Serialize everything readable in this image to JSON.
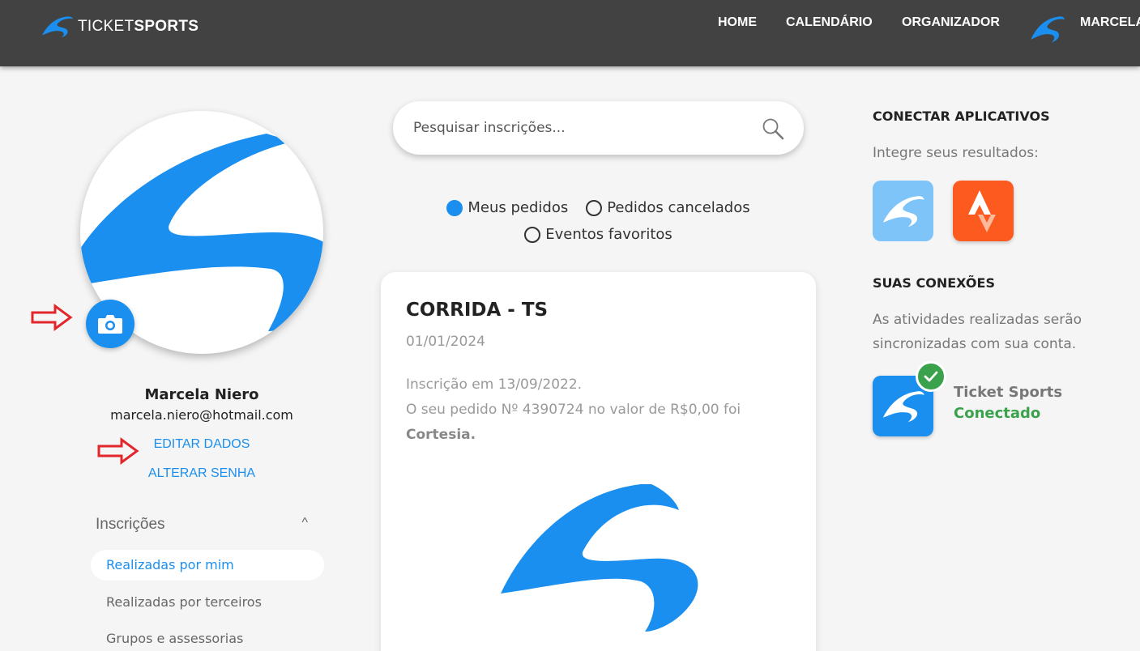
{
  "header": {
    "brand_prefix": "TICKET",
    "brand_bold": "SPORTS",
    "nav": [
      "HOME",
      "CALENDÁRIO",
      "ORGANIZADOR",
      "MARCELA"
    ]
  },
  "profile": {
    "name": "Marcela Niero",
    "email": "marcela.niero@hotmail.com",
    "edit_label": "EDITAR DADOS",
    "password_label": "ALTERAR SENHA"
  },
  "sidebar": {
    "section_title": "Inscrições",
    "toggle": "^",
    "items": [
      {
        "label": "Realizadas por mim",
        "active": true
      },
      {
        "label": "Realizadas por terceiros",
        "active": false
      },
      {
        "label": "Grupos e assessorias",
        "active": false
      }
    ]
  },
  "search": {
    "placeholder": "Pesquisar inscrições..."
  },
  "filters": [
    {
      "label": "Meus pedidos",
      "selected": true
    },
    {
      "label": "Pedidos cancelados",
      "selected": false
    },
    {
      "label": "Eventos favoritos",
      "selected": false
    }
  ],
  "order_card": {
    "title": "CORRIDA - TS",
    "date": "01/01/2024",
    "line1": "Inscrição em 13/09/2022.",
    "line2": "O seu pedido Nº 4390724 no valor de R$0,00 foi",
    "status": "Cortesia."
  },
  "right": {
    "apps_title": "CONECTAR APLICATIVOS",
    "apps_subtitle": "Integre seus resultados:",
    "connections_title": "SUAS CONEXÕES",
    "connections_text_1": "As atividades realizadas serão",
    "connections_text_2": "sincronizadas com sua conta.",
    "connection_name": "Ticket Sports",
    "connection_status": "Conectado"
  },
  "colors": {
    "accent": "#1a8ff0",
    "header": "#424242",
    "success": "#3aa24c",
    "strava": "#fc5a1e"
  }
}
